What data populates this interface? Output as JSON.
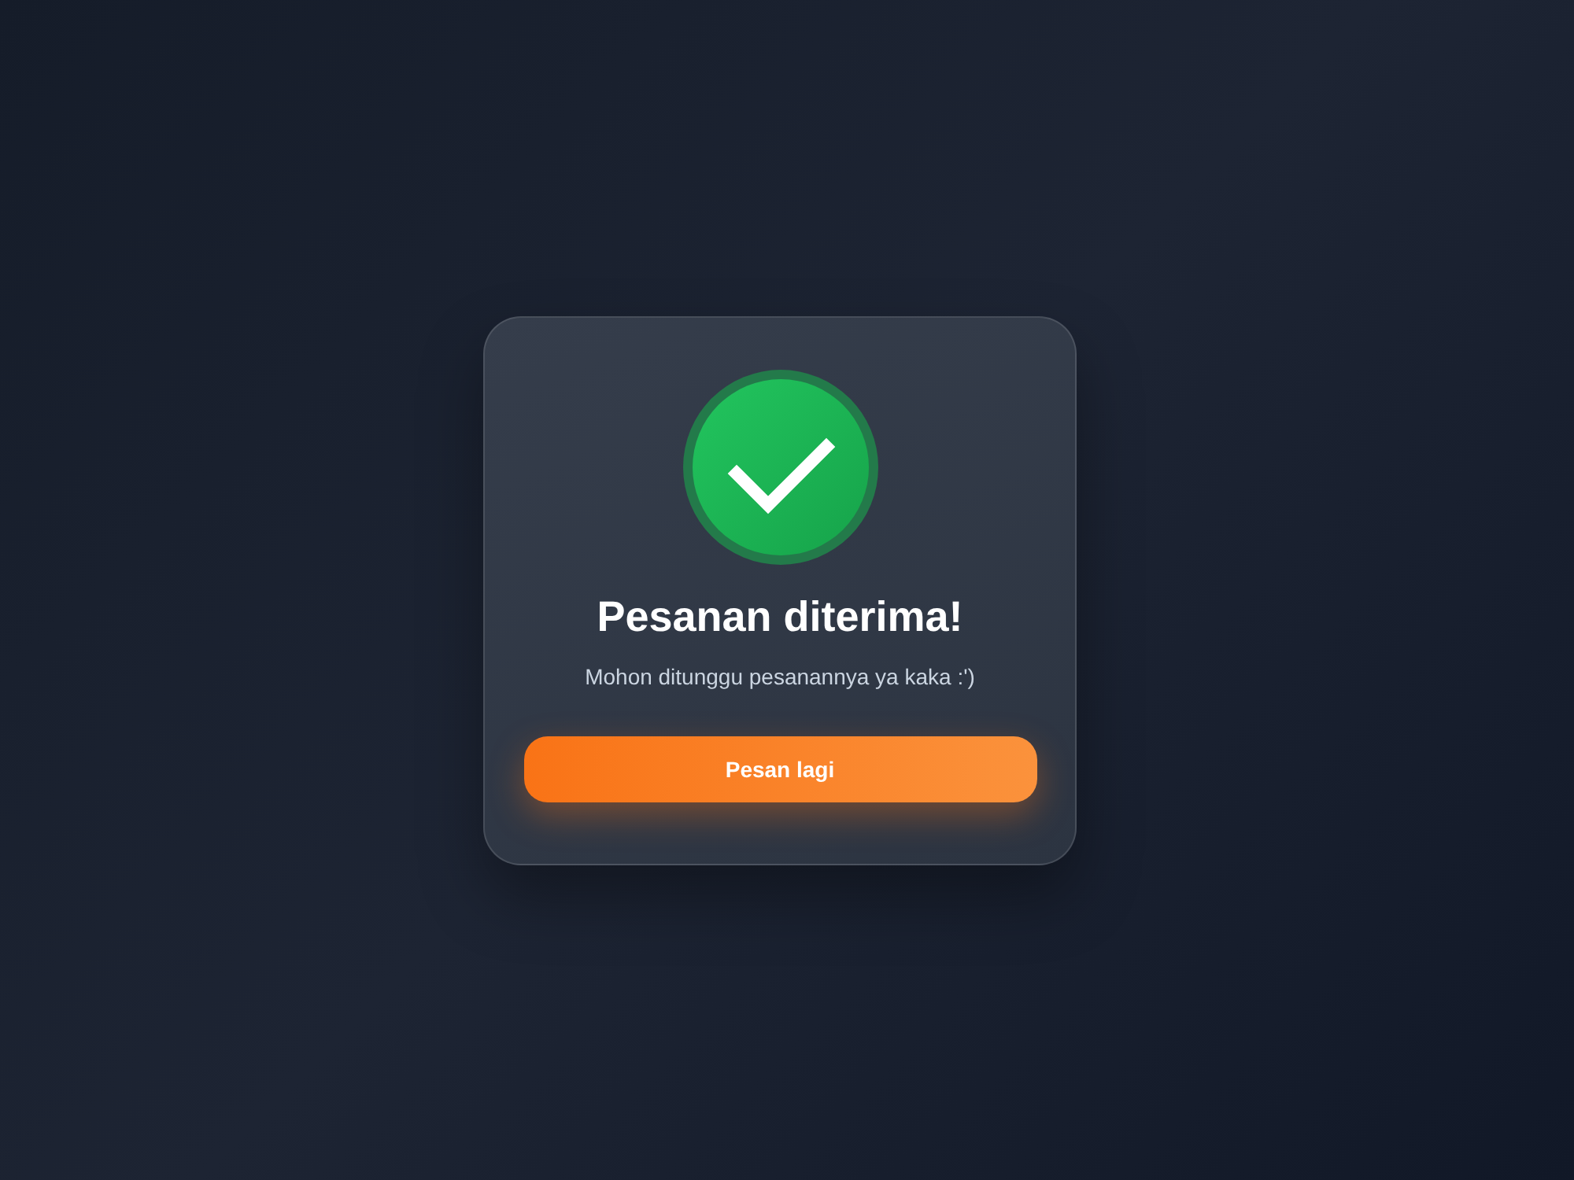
{
  "dialog": {
    "title": "Pesanan diterima!",
    "message": "Mohon ditunggu pesanannya ya kaka :')",
    "button": "Pesan lagi"
  }
}
